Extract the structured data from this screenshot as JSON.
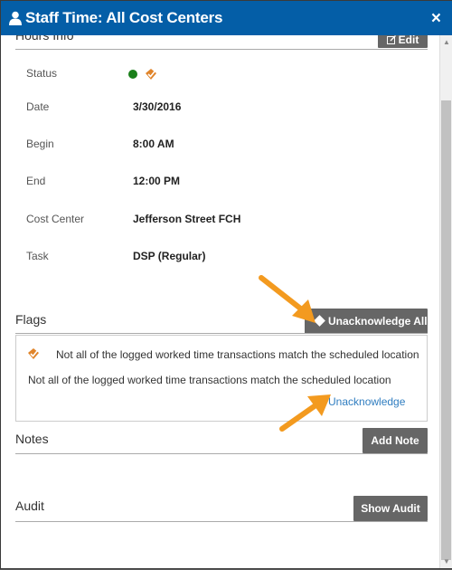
{
  "header": {
    "title": "Staff Time: All Cost Centers",
    "close_label": "×"
  },
  "hours": {
    "title": "Hours Info",
    "edit_label": "Edit",
    "rows": [
      {
        "label": "Status",
        "value": ""
      },
      {
        "label": "Date",
        "value": "3/30/2016"
      },
      {
        "label": "Begin",
        "value": "8:00 AM"
      },
      {
        "label": "End",
        "value": "12:00 PM"
      },
      {
        "label": "Cost Center",
        "value": "Jefferson Street FCH"
      },
      {
        "label": "Task",
        "value": "DSP (Regular)"
      }
    ]
  },
  "flags": {
    "title": "Flags",
    "unacknowledge_all_label": "Unacknowledge All",
    "item": {
      "summary": "Not all of the logged worked time transactions match the scheduled location",
      "detail": "Not all of the logged worked time transactions match the scheduled location",
      "unacknowledge_label": "Unacknowledge"
    }
  },
  "notes": {
    "title": "Notes",
    "add_note_label": "Add Note"
  },
  "audit": {
    "title": "Audit",
    "show_audit_label": "Show Audit"
  },
  "colors": {
    "header_bg": "#045ea7",
    "button_bg": "#666666",
    "link": "#2f7dc0",
    "status_ok": "#1a7f1a",
    "flag_orange": "#e0842a",
    "annotation_arrow": "#f39a1f"
  },
  "icons": {
    "header": "user-icon",
    "close": "close-icon",
    "edit": "edit-icon",
    "status": "status-dot-icon",
    "flag": "flag-check-icon",
    "unacknowledge_all": "diamond-icon"
  }
}
